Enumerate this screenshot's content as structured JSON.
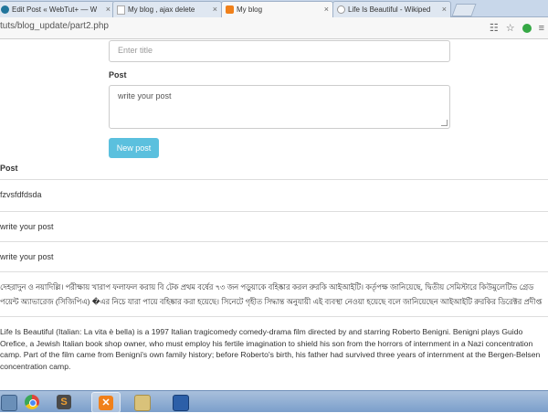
{
  "browser": {
    "tabs": [
      {
        "label": "Edit Post « WebTut+ — W",
        "active": false,
        "icon": "wordpress-icon"
      },
      {
        "label": "My blog , ajax delete",
        "active": false,
        "icon": "page-icon"
      },
      {
        "label": "My blog",
        "active": true,
        "icon": "xampp-icon"
      },
      {
        "label": "Life Is Beautiful - Wikiped",
        "active": false,
        "icon": "wikipedia-icon"
      }
    ],
    "close_glyph": "×",
    "url": "tuts/blog_update/part2.php"
  },
  "form": {
    "title_placeholder": "Enter title",
    "post_label": "Post",
    "post_placeholder": "write your post",
    "submit_label": "New post"
  },
  "posts": {
    "heading": "Post",
    "items": [
      "fzvsfdfdsda",
      "write your post",
      "write your post",
      "দেহরাদুন ও নয়াদিল্লি। পরীক্ষায় খারাপ ফলাফল করায় বি টেক প্রথম বর্ষের ৭৩ জন পড়ুয়াকে বহিষ্কার করল রুরকি আইআইটি। কর্তৃপক্ষ জানিয়েছে, দ্বিতীয় সেমিস্টারে কিউমুলেটিভ গ্রেড পয়েন্ট অ্যাভারেজ (সিজিপিএ) �এর নিচে যারা পায়ে বহিষ্কার করা হয়েছে। সিনেটে গৃহীত সিদ্ধান্ত অনুযায়ী এই ব্যবস্থা নেওয়া হয়েছে বলে জানিয়েছেন আইআইটি রুরকির ডিরেক্টর প্রদীপ্ত বন্দ্যোপাধ্যায়।",
      "Life Is Beautiful (Italian: La vita è bella) is a 1997 Italian tragicomedy comedy-drama film directed by and starring Roberto Benigni. Benigni plays Guido Orefice, a Jewish Italian book shop owner, who must employ his fertile imagination to shield his son from the horrors of internment in a Nazi concentration camp. Part of the film came from Benigni's own family history; before Roberto's birth, his father had survived three years of internment at the Bergen-Belsen concentration camp."
    ]
  },
  "taskbar": {
    "items": [
      {
        "icon": "explorer-icon",
        "color": "#6a8fb8"
      },
      {
        "icon": "chrome-icon",
        "color": "#e0453a"
      },
      {
        "icon": "sublime-text-icon",
        "color": "#4a4a4a"
      },
      {
        "icon": "xampp-icon",
        "color": "#f0801a"
      },
      {
        "icon": "paint-icon",
        "color": "#d9c27a"
      },
      {
        "icon": "remote-desktop-icon",
        "color": "#2c5fa8"
      }
    ]
  },
  "colors": {
    "accent_button": "#5bc0de",
    "tab_active": "#f7f7f7",
    "taskbar": "#7b9fcb"
  }
}
